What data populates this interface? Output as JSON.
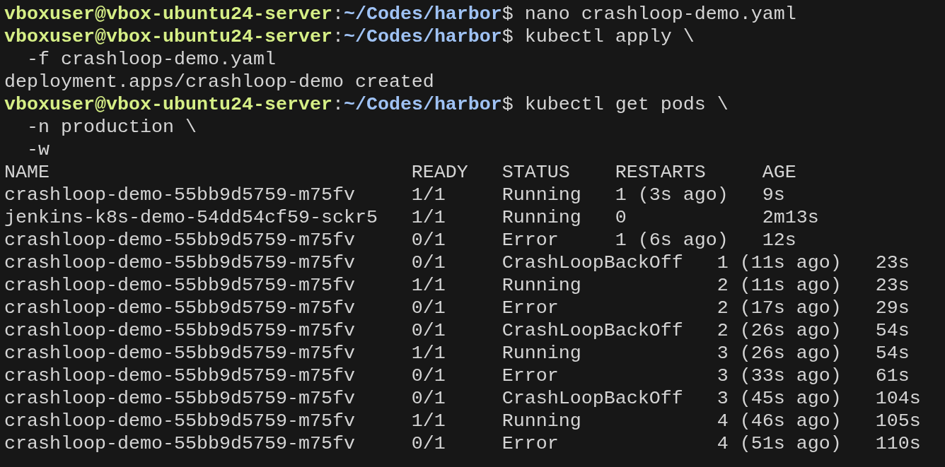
{
  "terminal": {
    "lines": [
      {
        "kind": "prompt",
        "user_host": "vboxuser@vbox-ubuntu24-server",
        "separator": ":",
        "path": "~/Codes/harbor",
        "command": "$ nano crashloop-demo.yaml"
      },
      {
        "kind": "prompt",
        "user_host": "vboxuser@vbox-ubuntu24-server",
        "separator": ":",
        "path": "~/Codes/harbor",
        "command": "$ kubectl apply \\"
      },
      {
        "kind": "output",
        "text": "  -f crashloop-demo.yaml"
      },
      {
        "kind": "output",
        "text": "deployment.apps/crashloop-demo created"
      },
      {
        "kind": "prompt",
        "user_host": "vboxuser@vbox-ubuntu24-server",
        "separator": ":",
        "path": "~/Codes/harbor",
        "command": "$ kubectl get pods \\"
      },
      {
        "kind": "output",
        "text": "  -n production \\"
      },
      {
        "kind": "output",
        "text": "  -w"
      },
      {
        "kind": "output",
        "text": "NAME                                READY   STATUS    RESTARTS     AGE"
      },
      {
        "kind": "output",
        "text": "crashloop-demo-55bb9d5759-m75fv     1/1     Running   1 (3s ago)   9s"
      },
      {
        "kind": "output",
        "text": "jenkins-k8s-demo-54dd54cf59-sckr5   1/1     Running   0            2m13s"
      },
      {
        "kind": "output",
        "text": "crashloop-demo-55bb9d5759-m75fv     0/1     Error     1 (6s ago)   12s"
      },
      {
        "kind": "output",
        "text": "crashloop-demo-55bb9d5759-m75fv     0/1     CrashLoopBackOff   1 (11s ago)   23s"
      },
      {
        "kind": "output",
        "text": "crashloop-demo-55bb9d5759-m75fv     1/1     Running            2 (11s ago)   23s"
      },
      {
        "kind": "output",
        "text": "crashloop-demo-55bb9d5759-m75fv     0/1     Error              2 (17s ago)   29s"
      },
      {
        "kind": "output",
        "text": "crashloop-demo-55bb9d5759-m75fv     0/1     CrashLoopBackOff   2 (26s ago)   54s"
      },
      {
        "kind": "output",
        "text": "crashloop-demo-55bb9d5759-m75fv     1/1     Running            3 (26s ago)   54s"
      },
      {
        "kind": "output",
        "text": "crashloop-demo-55bb9d5759-m75fv     0/1     Error              3 (33s ago)   61s"
      },
      {
        "kind": "output",
        "text": "crashloop-demo-55bb9d5759-m75fv     0/1     CrashLoopBackOff   3 (45s ago)   104s"
      },
      {
        "kind": "output",
        "text": "crashloop-demo-55bb9d5759-m75fv     1/1     Running            4 (46s ago)   105s"
      },
      {
        "kind": "output",
        "text": "crashloop-demo-55bb9d5759-m75fv     0/1     Error              4 (51s ago)   110s"
      }
    ]
  }
}
